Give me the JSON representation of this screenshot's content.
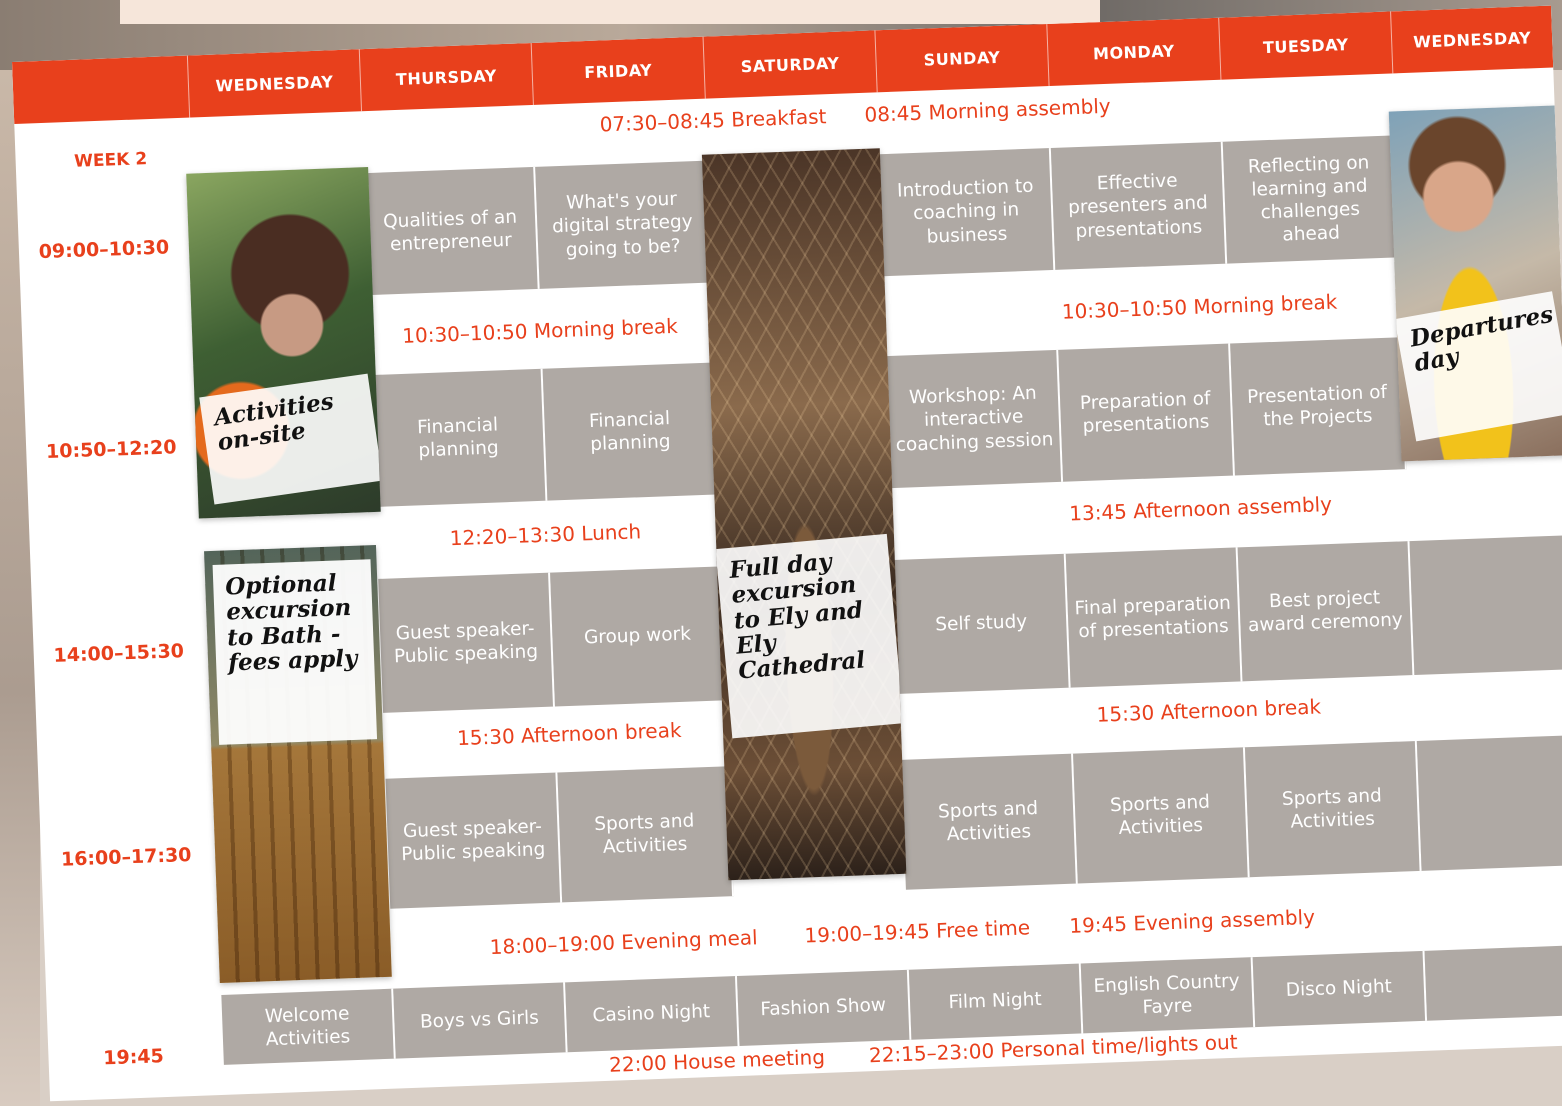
{
  "days": [
    "WEDNESDAY",
    "THURSDAY",
    "FRIDAY",
    "SATURDAY",
    "SUNDAY",
    "MONDAY",
    "TUESDAY",
    "WEDNESDAY"
  ],
  "week_label": "WEEK 2",
  "times": {
    "t1": "09:00–10:30",
    "t2": "10:50–12:20",
    "t3": "14:00–15:30",
    "t4": "16:00–17:30",
    "t5": "19:45"
  },
  "bands": {
    "breakfast": "07:30–08:45 Breakfast",
    "assembly": "08:45 Morning assembly",
    "break_left": "10:30–10:50 Morning break",
    "break_right": "10:30–10:50 Morning break",
    "lunch": "12:20–13:30 Lunch",
    "afternoon_assembly": "13:45 Afternoon assembly",
    "afternoon_break_left": "15:30 Afternoon break",
    "afternoon_break_right": "15:30 Afternoon break",
    "evening_meal": "18:00–19:00  Evening meal",
    "free_time": "19:00–19:45 Free time",
    "evening_assembly": "19:45 Evening assembly",
    "house_meeting": "22:00 House meeting",
    "lights_out": "22:15–23:00 Personal time/lights out"
  },
  "row1": {
    "thu": "Qualities of an entrepreneur",
    "fri": "What's your digital strategy going to be?",
    "sun": "Introduction to coaching in business",
    "mon": "Effective presenters and presentations",
    "tue": "Reflecting on learning and challenges ahead"
  },
  "row2": {
    "thu": "Financial planning",
    "fri": "Financial planning",
    "sun": "Workshop: An interactive coaching session",
    "mon": "Preparation of presentations",
    "tue": "Presentation of the Projects"
  },
  "row3": {
    "thu": "Guest speaker- Public speaking",
    "fri": "Group work",
    "sun": "Self study",
    "mon": "Final preparation of presentations",
    "tue": "Best project award ceremony"
  },
  "row4": {
    "thu": "Guest speaker- Public speaking",
    "fri": "Sports and Activities",
    "sun": "Sports and Activities",
    "mon": "Sports and Activities",
    "tue": "Sports and Activities"
  },
  "row5": {
    "wed": "Welcome Activities",
    "thu": "Boys vs Girls",
    "fri": "Casino Night",
    "sat": "Fashion Show",
    "sun": "Film Night",
    "mon": "English Country Fayre",
    "tue": "Disco Night"
  },
  "notes": {
    "activities": "Activities on-site",
    "bath": "Optional excursion to Bath - fees apply",
    "ely": "Full day excursion to Ely and Ely Cathedral",
    "departures": "Departures day"
  },
  "colors": {
    "accent": "#e8401c",
    "cell": "#afa9a4"
  }
}
